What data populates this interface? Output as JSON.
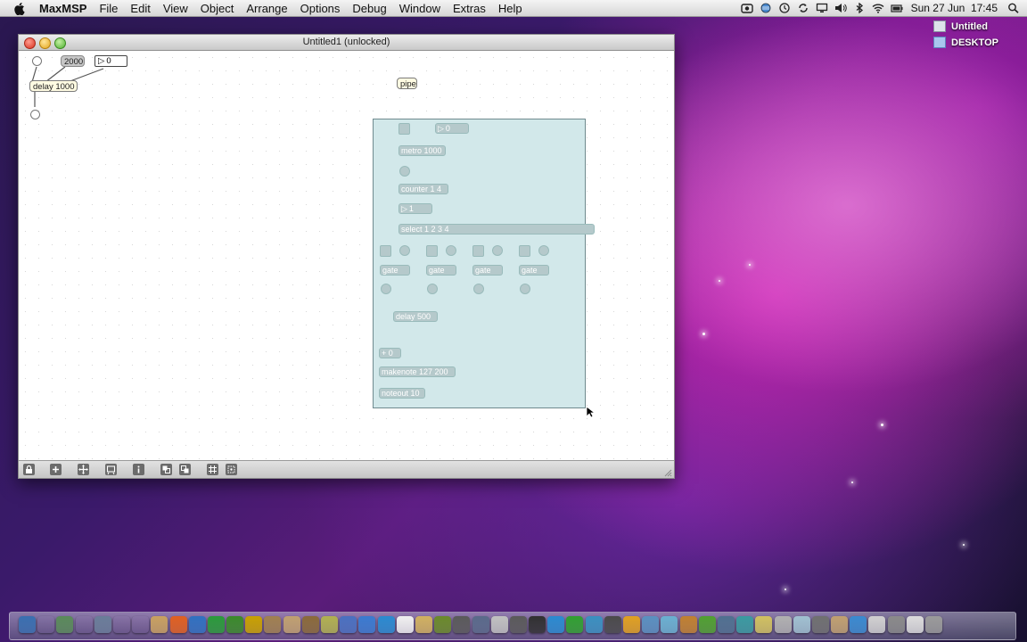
{
  "menubar": {
    "app_name": "MaxMSP",
    "menus": [
      "File",
      "Edit",
      "View",
      "Object",
      "Arrange",
      "Options",
      "Debug",
      "Window",
      "Extras",
      "Help"
    ],
    "clock": "Sun 27 Jun  17:45"
  },
  "desktop": {
    "items": [
      {
        "label": "Untitled"
      },
      {
        "label": "DESKTOP"
      }
    ]
  },
  "window": {
    "title": "Untitled1 (unlocked)",
    "patch": {
      "number_2000": "2000",
      "number_zero": "0",
      "delay_object": "delay 1000",
      "pipe_object": "pipe"
    },
    "subpatch": {
      "number_zero": "0",
      "metro": "metro 1000",
      "counter": "counter 1 4",
      "number_one": "1",
      "select": "select 1 2 3 4",
      "gate_1": "gate",
      "gate_2": "gate",
      "gate_3": "gate",
      "gate_4": "gate",
      "delay": "delay 500",
      "plus_zero": "+ 0",
      "makenote": "makenote 127 200",
      "noteout": "noteout 10"
    }
  },
  "dock": {
    "colors": [
      "#3a6fb0",
      "#555",
      "#5a8a5a",
      "#888",
      "#6a7d99",
      "#222",
      "#444",
      "#c8a060",
      "#e06020",
      "#3070c0",
      "#2a9a3a",
      "#3a8a2a",
      "#c8a000",
      "#a08050",
      "#c0a070",
      "#8a6a3a",
      "#b0b050",
      "#4a70c0",
      "#3a7ad0",
      "#2a8ad0",
      "#f0f0f0",
      "#d0b060",
      "#6a8a2a",
      "#5a5a5a",
      "#5a6a8a",
      "#c0c0c0",
      "#5a5a5a",
      "#303030",
      "#2a8ad0",
      "#30a030",
      "#3a90c0",
      "#4a4a4a",
      "#e0a020",
      "#5a90c0",
      "#6ab0d0",
      "#c08030",
      "#50a030",
      "#507090",
      "#3a9aa0",
      "#d0c060",
      "#b0b0b0",
      "#a0c0d0",
      "#707070",
      "#c0a070",
      "#3a8ad0",
      "#d0d0d0",
      "#8a8a8a",
      "#dcdcdc",
      "#9a9a9a"
    ]
  }
}
